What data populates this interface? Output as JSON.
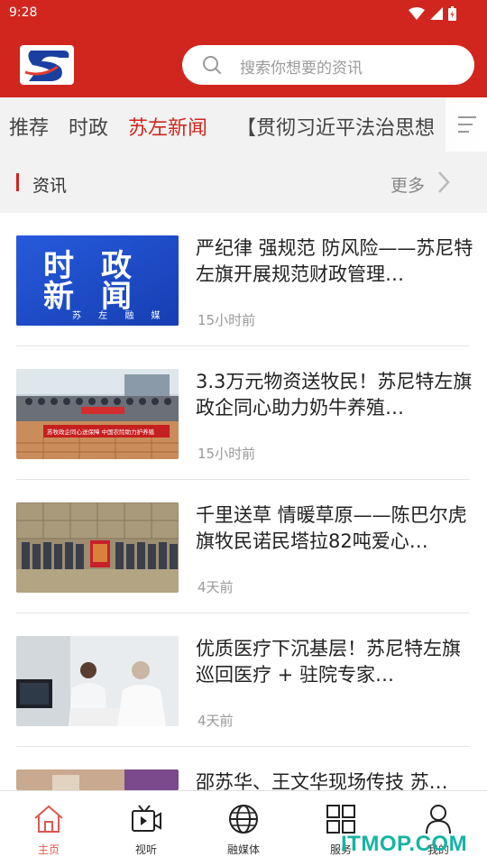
{
  "status_bar": {
    "time": "9:28"
  },
  "header": {
    "logo_name": "app-logo",
    "search_placeholder": "搜索你想要的资讯"
  },
  "tabs": [
    {
      "label": "推荐",
      "active": false
    },
    {
      "label": "时政",
      "active": false
    },
    {
      "label": "苏左新闻",
      "active": true
    },
    {
      "label": "【贯彻习近平法治思想",
      "active": false
    }
  ],
  "section": {
    "title": "资讯",
    "more_label": "更多"
  },
  "news": [
    {
      "title": "严纪律 强规范 防风险——苏尼特左旗开展规范财政管理…",
      "time": "15小时前"
    },
    {
      "title": "3.3万元物资送牧民！苏尼特左旗政企同心助力奶牛养殖…",
      "time": "15小时前"
    },
    {
      "title": "千里送草 情暖草原——陈巴尔虎旗牧民诺民塔拉82吨爱心…",
      "time": "4天前"
    },
    {
      "title": "优质医疗下沉基层！苏尼特左旗巡回医疗 + 驻院专家…",
      "time": "4天前"
    },
    {
      "title": "邵苏华、王文华现场传技 苏…",
      "time": ""
    }
  ],
  "thumbs": {
    "t1_line1": "时政",
    "t1_line2": "新闻",
    "t1_sub": "苏 左 融 媒",
    "t2_banner": "苏牧政企同心送保障 中国农险助力护养殖"
  },
  "bottom_nav": [
    {
      "label": "主页",
      "active": true
    },
    {
      "label": "视听",
      "active": false
    },
    {
      "label": "融媒体",
      "active": false
    },
    {
      "label": "服务",
      "active": false
    },
    {
      "label": "我的",
      "active": false
    }
  ],
  "watermark": "ITMOP.COM",
  "colors": {
    "brand_red": "#d0261e",
    "active_nav": "#e0574f",
    "watermark": "#17b3a3"
  }
}
